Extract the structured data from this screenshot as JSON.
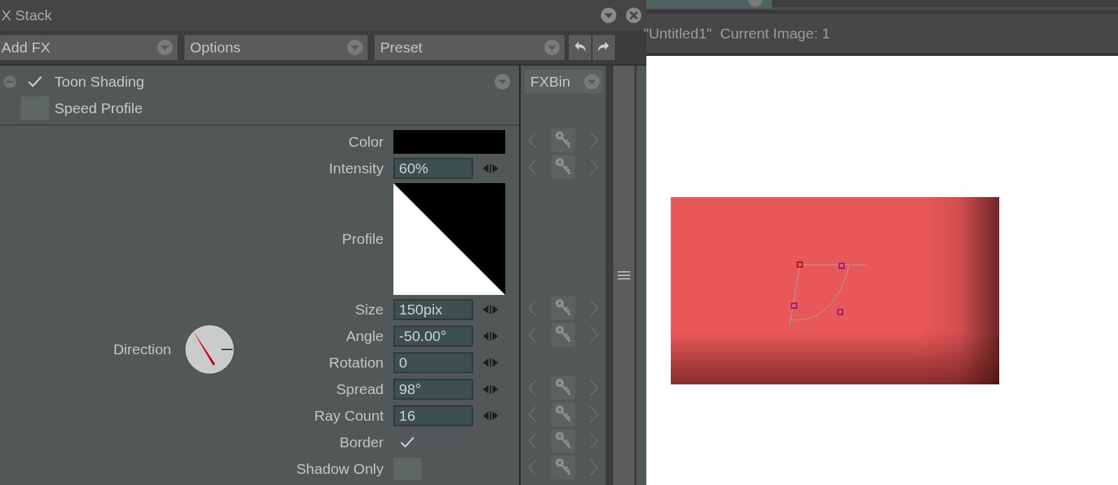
{
  "panel": {
    "title": "X Stack"
  },
  "toolbar": {
    "dropdowns": [
      {
        "label": "Add FX"
      },
      {
        "label": "Options"
      },
      {
        "label": "Preset"
      }
    ]
  },
  "effects": [
    {
      "label": "Toon Shading",
      "checked": true,
      "removable": true
    },
    {
      "label": "Speed Profile",
      "checked": false,
      "removable": false
    }
  ],
  "fxbin": {
    "label": "FXBin"
  },
  "direction": {
    "label": "Direction"
  },
  "params": [
    {
      "kind": "color",
      "label": "Color",
      "color": "#000000",
      "keyframe": true
    },
    {
      "kind": "number",
      "label": "Intensity",
      "value": "60%",
      "keyframe": true
    },
    {
      "kind": "profile",
      "label": "Profile",
      "keyframe": false
    },
    {
      "kind": "number",
      "label": "Size",
      "value": "150pix",
      "keyframe": true
    },
    {
      "kind": "number",
      "label": "Angle",
      "value": "-50.00°",
      "keyframe": true
    },
    {
      "kind": "number",
      "label": "Rotation",
      "value": "0",
      "keyframe": false
    },
    {
      "kind": "number",
      "label": "Spread",
      "value": "98°",
      "keyframe": true
    },
    {
      "kind": "number",
      "label": "Ray Count",
      "value": "16",
      "keyframe": true
    },
    {
      "kind": "check",
      "label": "Border",
      "checked": true,
      "keyframe": true
    },
    {
      "kind": "check",
      "label": "Shadow Only",
      "checked": false,
      "keyframe": true
    }
  ],
  "viewer": {
    "info": "\"Untitled1\"  Current Image: 1"
  }
}
